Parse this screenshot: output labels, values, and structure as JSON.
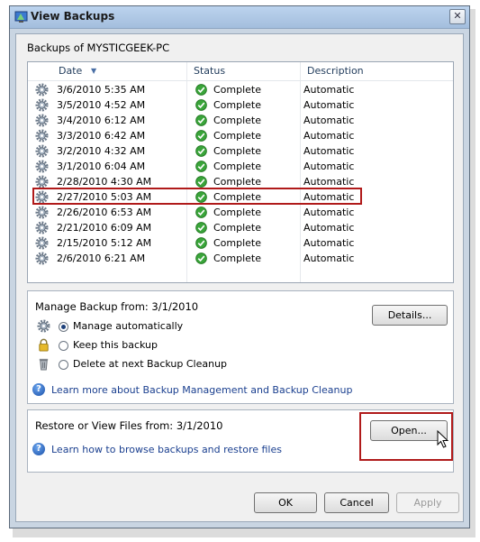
{
  "window": {
    "title": "View Backups",
    "close_symbol": "✕"
  },
  "heading": "Backups of MYSTICGEEK-PC",
  "columns": {
    "date": "Date",
    "sort_arrow": "▼",
    "status": "Status",
    "description": "Description"
  },
  "rows": [
    {
      "date": "3/6/2010 5:35 AM",
      "status": "Complete",
      "description": "Automatic"
    },
    {
      "date": "3/5/2010 4:52 AM",
      "status": "Complete",
      "description": "Automatic"
    },
    {
      "date": "3/4/2010 6:12 AM",
      "status": "Complete",
      "description": "Automatic"
    },
    {
      "date": "3/3/2010 6:42 AM",
      "status": "Complete",
      "description": "Automatic"
    },
    {
      "date": "3/2/2010 4:32 AM",
      "status": "Complete",
      "description": "Automatic"
    },
    {
      "date": "3/1/2010 6:04 AM",
      "status": "Complete",
      "description": "Automatic"
    },
    {
      "date": "2/28/2010 4:30 AM",
      "status": "Complete",
      "description": "Automatic"
    },
    {
      "date": "2/27/2010 5:03 AM",
      "status": "Complete",
      "description": "Automatic"
    },
    {
      "date": "2/26/2010 6:53 AM",
      "status": "Complete",
      "description": "Automatic"
    },
    {
      "date": "2/21/2010 6:09 AM",
      "status": "Complete",
      "description": "Automatic"
    },
    {
      "date": "2/15/2010 5:12 AM",
      "status": "Complete",
      "description": "Automatic"
    },
    {
      "date": "2/6/2010 6:21 AM",
      "status": "Complete",
      "description": "Automatic"
    }
  ],
  "selected_row_index": 5,
  "manage": {
    "title": "Manage Backup from: 3/1/2010",
    "details_button": "Details...",
    "options": [
      {
        "label": "Manage automatically",
        "icon": "gear-icon",
        "selected": true
      },
      {
        "label": "Keep this backup",
        "icon": "lock-icon",
        "selected": false
      },
      {
        "label": "Delete at next Backup Cleanup",
        "icon": "trash-icon",
        "selected": false
      }
    ],
    "help_link": "Learn more about Backup Management and Backup Cleanup"
  },
  "restore": {
    "title": "Restore or View Files from: 3/1/2010",
    "open_button": "Open...",
    "help_link": "Learn how to browse backups and restore files"
  },
  "footer": {
    "ok": "OK",
    "cancel": "Cancel",
    "apply": "Apply"
  },
  "colors": {
    "highlight_border": "#b01a1a",
    "link": "#1a3f8f",
    "check_green": "#3aa53a"
  }
}
